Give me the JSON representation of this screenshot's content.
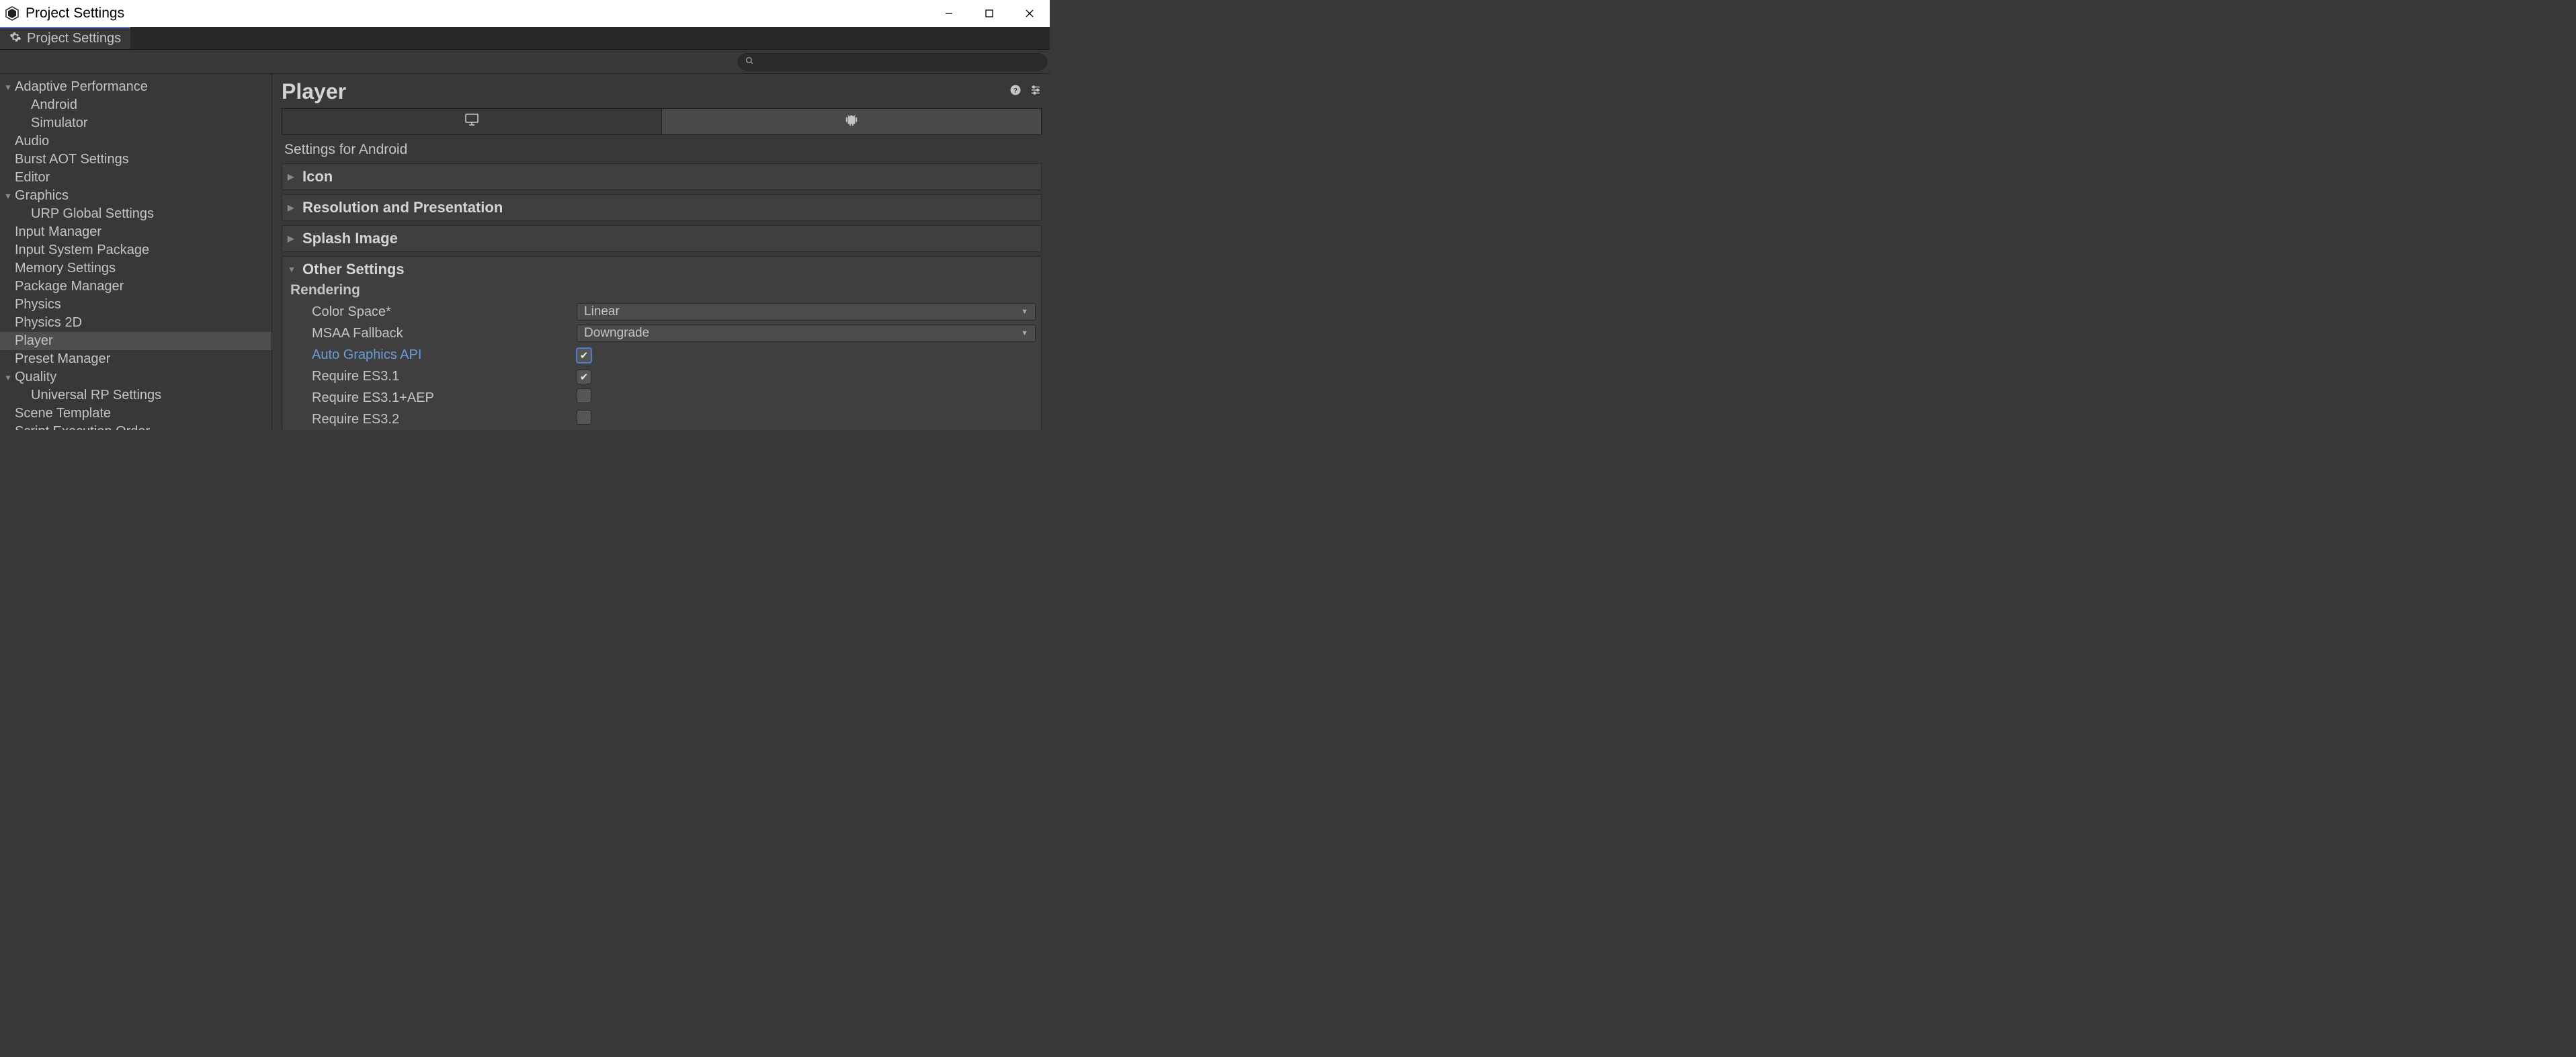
{
  "window": {
    "title": "Project Settings"
  },
  "tab": {
    "label": "Project Settings"
  },
  "search": {
    "placeholder": ""
  },
  "sidebar": {
    "items": [
      {
        "label": "Adaptive Performance",
        "depth": 0,
        "expandable": true,
        "expanded": true
      },
      {
        "label": "Android",
        "depth": 1
      },
      {
        "label": "Simulator",
        "depth": 1
      },
      {
        "label": "Audio",
        "depth": 0
      },
      {
        "label": "Burst AOT Settings",
        "depth": 0
      },
      {
        "label": "Editor",
        "depth": 0
      },
      {
        "label": "Graphics",
        "depth": 0,
        "expandable": true,
        "expanded": true
      },
      {
        "label": "URP Global Settings",
        "depth": 1
      },
      {
        "label": "Input Manager",
        "depth": 0
      },
      {
        "label": "Input System Package",
        "depth": 0
      },
      {
        "label": "Memory Settings",
        "depth": 0
      },
      {
        "label": "Package Manager",
        "depth": 0
      },
      {
        "label": "Physics",
        "depth": 0
      },
      {
        "label": "Physics 2D",
        "depth": 0
      },
      {
        "label": "Player",
        "depth": 0,
        "selected": true
      },
      {
        "label": "Preset Manager",
        "depth": 0
      },
      {
        "label": "Quality",
        "depth": 0,
        "expandable": true,
        "expanded": true
      },
      {
        "label": "Universal RP Settings",
        "depth": 1
      },
      {
        "label": "Scene Template",
        "depth": 0
      },
      {
        "label": "Script Execution Order",
        "depth": 0
      }
    ]
  },
  "content": {
    "title": "Player",
    "platform_subtitle": "Settings for Android",
    "foldouts": {
      "icon": "Icon",
      "resolution": "Resolution and Presentation",
      "splash": "Splash Image",
      "other": "Other Settings"
    },
    "rendering": {
      "section": "Rendering",
      "color_space_label": "Color Space*",
      "color_space_value": "Linear",
      "msaa_label": "MSAA Fallback",
      "msaa_value": "Downgrade",
      "auto_gfx_label": "Auto Graphics API",
      "auto_gfx_checked": true,
      "req_es31_label": "Require ES3.1",
      "req_es31_checked": true,
      "req_es31aep_label": "Require ES3.1+AEP",
      "req_es31aep_checked": false,
      "req_es32_label": "Require ES3.2",
      "req_es32_checked": false
    }
  }
}
